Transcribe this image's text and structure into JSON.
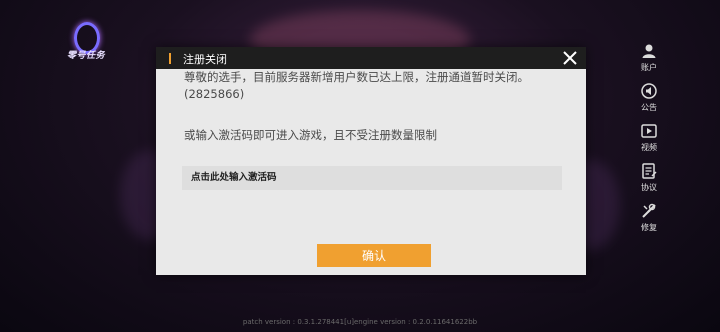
{
  "logo": {
    "text": "零号任务"
  },
  "sidebar": {
    "items": [
      {
        "label": "账户",
        "icon": "account-icon"
      },
      {
        "label": "公告",
        "icon": "announcement-icon"
      },
      {
        "label": "视频",
        "icon": "video-icon"
      },
      {
        "label": "协议",
        "icon": "agreement-icon"
      },
      {
        "label": "修复",
        "icon": "repair-icon"
      }
    ]
  },
  "dialog": {
    "title": "注册关闭",
    "message": "尊敬的选手，目前服务器新增用户数已达上限，注册通道暂时关闭。(2825866)",
    "code_hint": "或输入激活码即可进入游戏，且不受注册数量限制",
    "code_input_placeholder": "点击此处输入激活码",
    "confirm_label": "确认"
  },
  "footer": {
    "version": "patch version : 0.3.1.278441[u]engine version : 0.2.0.11641622bb"
  },
  "colors": {
    "accent": "#f0a030",
    "dialog_bg": "#e9e9e9",
    "header_bg": "#1e1e1e"
  }
}
